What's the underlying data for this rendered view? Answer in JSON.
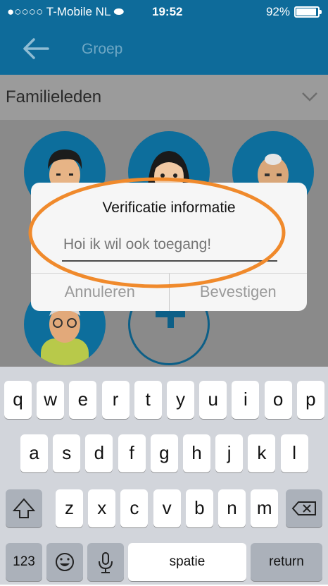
{
  "status_bar": {
    "carrier": "●○○○○ T-Mobile NL ⬬",
    "time": "19:52",
    "battery_percent": "92%",
    "battery_level": 0.92
  },
  "nav": {
    "title": "Groep",
    "back_icon": "arrow-left-icon"
  },
  "section": {
    "title": "Familieleden",
    "toggle_icon": "chevron-down-icon"
  },
  "members": [
    {
      "avatar": "man-dark-hair"
    },
    {
      "avatar": "woman-dark-hair"
    },
    {
      "avatar": "elderly-man-bald"
    },
    {
      "avatar": "man-glasses"
    }
  ],
  "add_member_icon": "plus-icon",
  "dialog": {
    "title": "Verificatie informatie",
    "input_value": "",
    "input_placeholder": "Hoi ik wil ook toegang!",
    "cancel_label": "Annuleren",
    "confirm_label": "Bevestigen"
  },
  "annotation": {
    "color": "#f08a2c"
  },
  "keyboard": {
    "row1": [
      "q",
      "w",
      "e",
      "r",
      "t",
      "y",
      "u",
      "i",
      "o",
      "p"
    ],
    "row2": [
      "a",
      "s",
      "d",
      "f",
      "g",
      "h",
      "j",
      "k",
      "l"
    ],
    "row3": [
      "z",
      "x",
      "c",
      "v",
      "b",
      "n",
      "m"
    ],
    "shift_icon": "shift-icon",
    "delete_icon": "backspace-icon",
    "numbers_label": "123",
    "emoji_icon": "emoji-icon",
    "mic_icon": "microphone-icon",
    "space_label": "spatie",
    "return_label": "return"
  },
  "colors": {
    "accent": "#0e6b9a",
    "dim_overlay": "#8a8a8a"
  }
}
